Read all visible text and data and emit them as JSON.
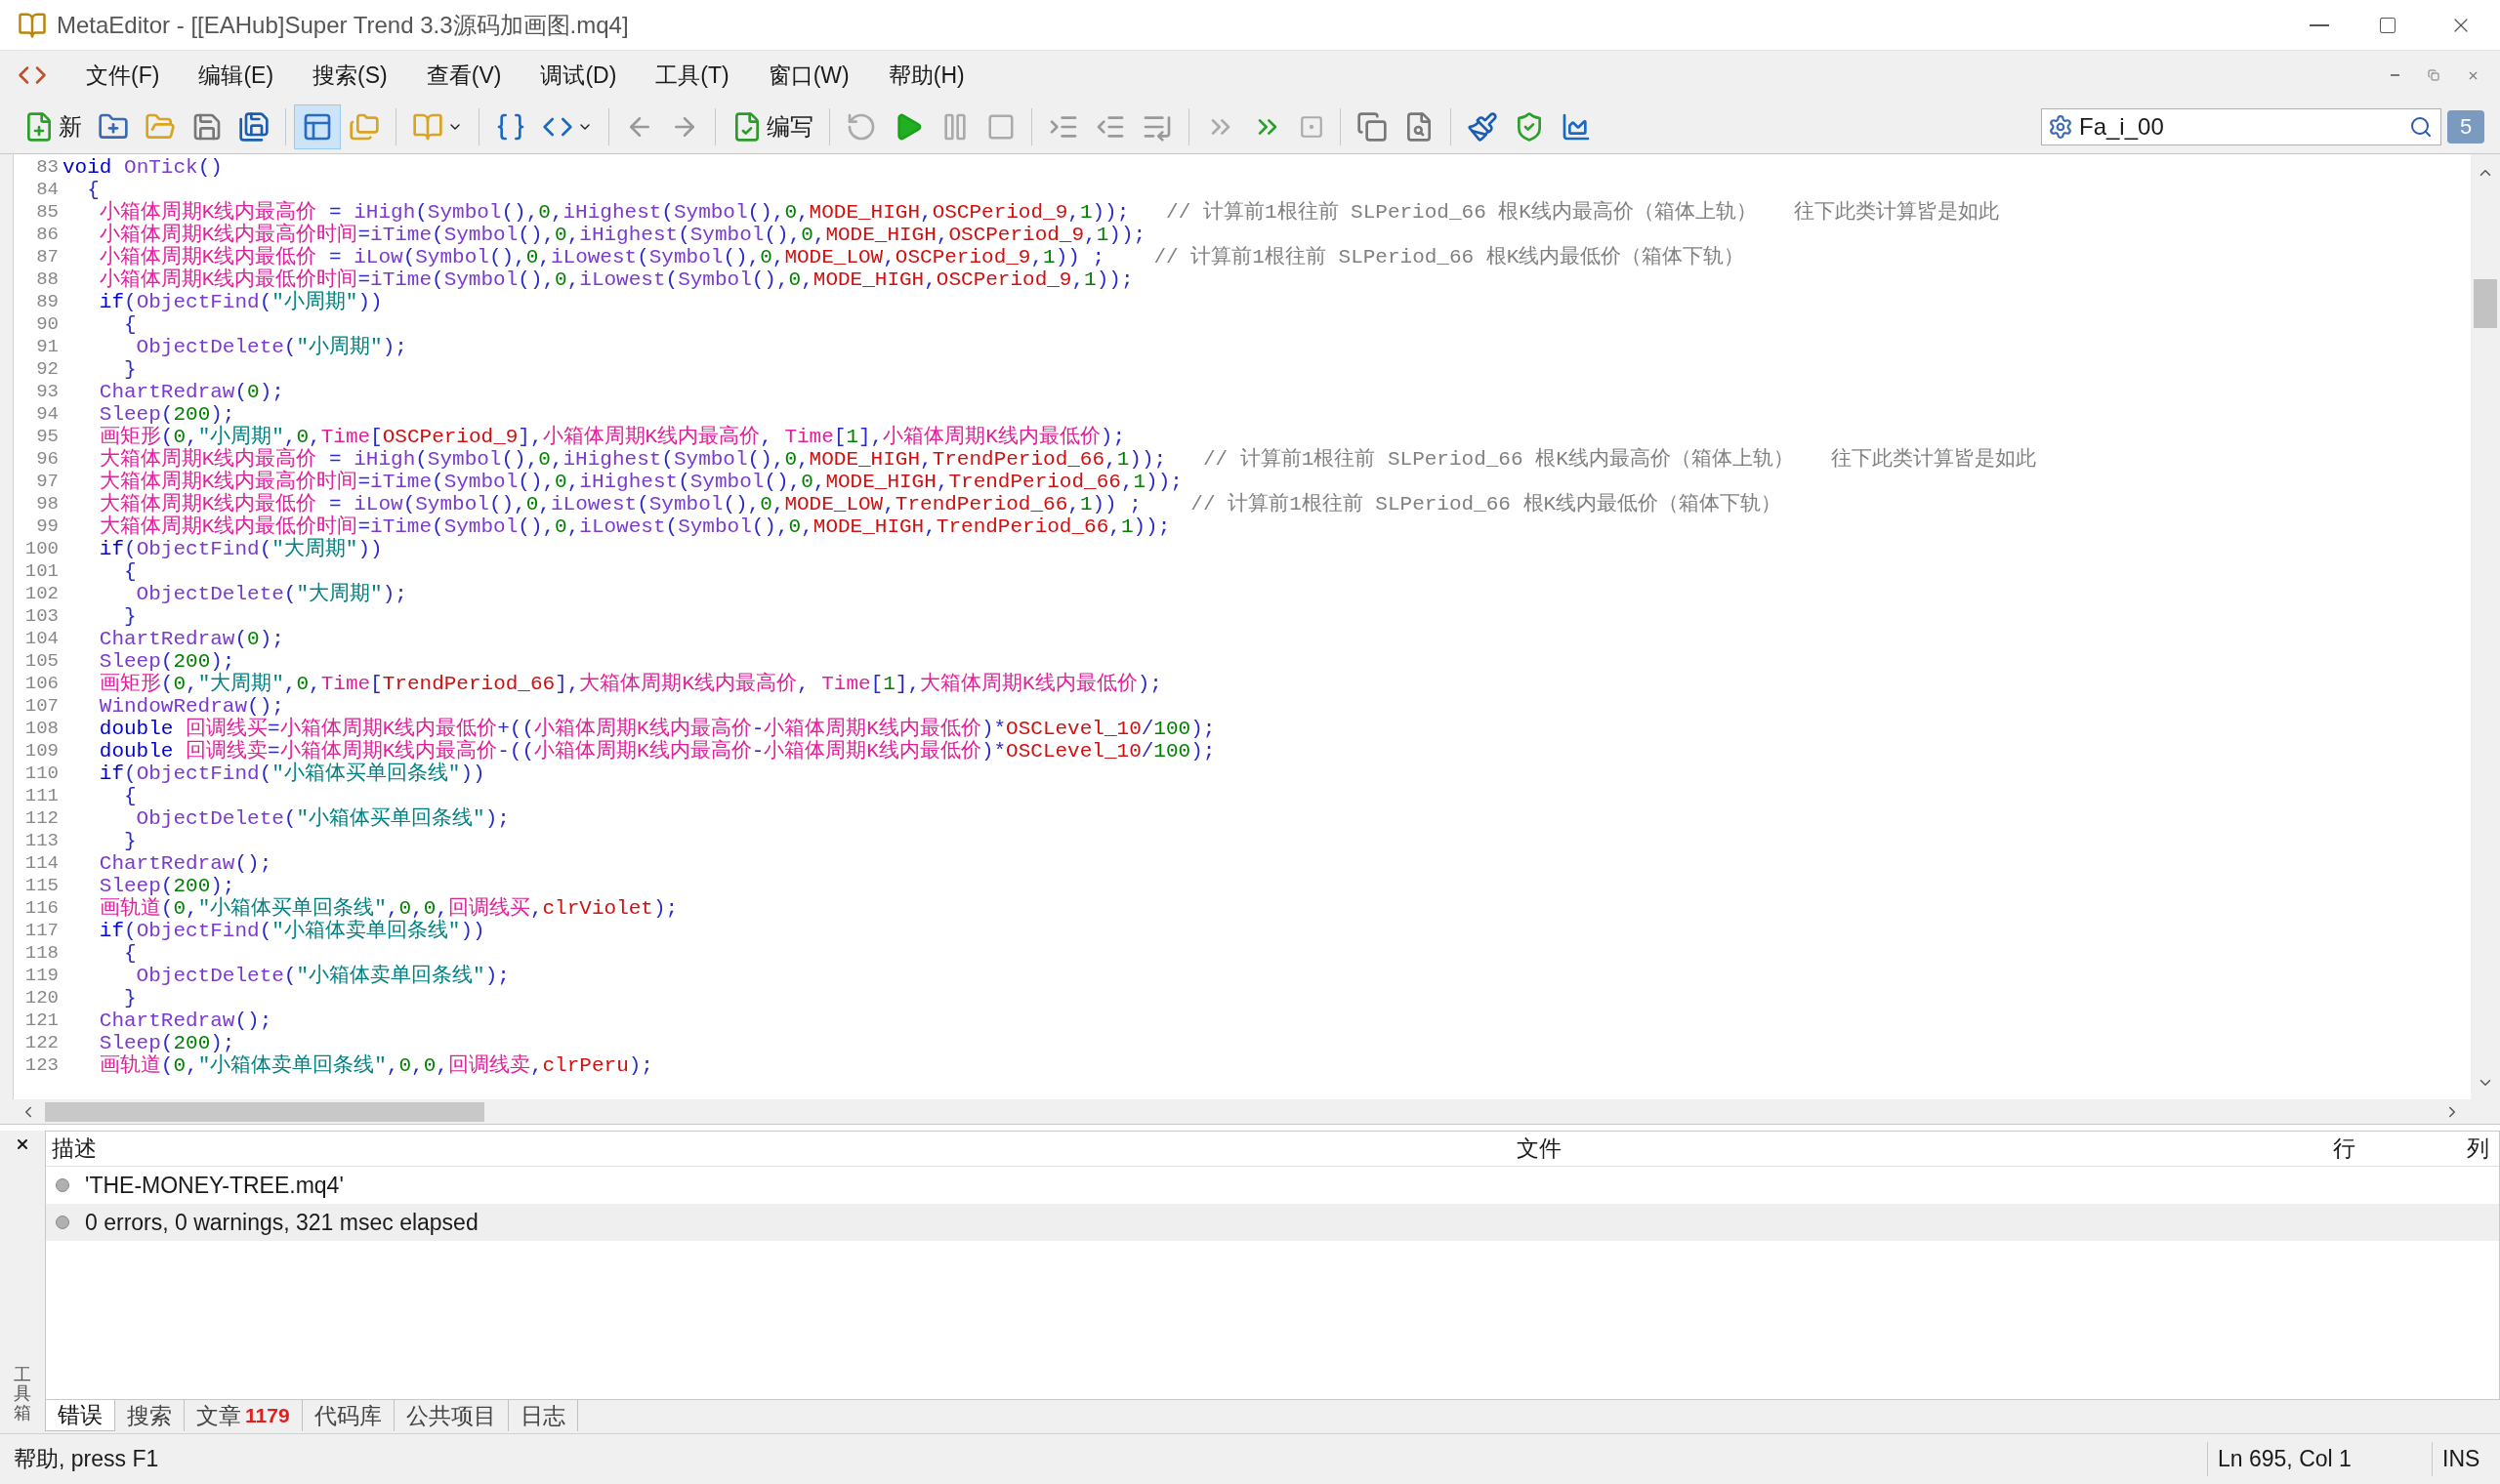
{
  "window": {
    "title": "MetaEditor - [[EAHub]Super Trend 3.3源码加画图.mq4]"
  },
  "menu": [
    "文件(F)",
    "编辑(E)",
    "搜索(S)",
    "查看(V)",
    "调试(D)",
    "工具(T)",
    "窗口(W)",
    "帮助(H)"
  ],
  "toolbar": {
    "new_label": "新",
    "compile_label": "编写",
    "navigator_on": true,
    "search_value": "Fa_i_00",
    "messages_count": "5"
  },
  "editor": {
    "lines": [
      {
        "number": "83",
        "tokens": [
          {
            "kind": "kw",
            "text": "void"
          },
          {
            "kind": "fn",
            "text": " OnTick"
          },
          {
            "kind": "p",
            "text": "()"
          }
        ]
      },
      {
        "number": "84",
        "tokens": [
          {
            "kind": "p",
            "text": "  {"
          }
        ]
      },
      {
        "number": "85",
        "tokens": [
          {
            "kind": "var",
            "text": "   小箱体周期K线内最高价"
          },
          {
            "kind": "p",
            "text": " = "
          },
          {
            "kind": "fn",
            "text": "iHigh"
          },
          {
            "kind": "p",
            "text": "("
          },
          {
            "kind": "fn",
            "text": "Symbol"
          },
          {
            "kind": "p",
            "text": "(),"
          },
          {
            "kind": "num",
            "text": "0"
          },
          {
            "kind": "p",
            "text": ","
          },
          {
            "kind": "fn",
            "text": "iHighest"
          },
          {
            "kind": "p",
            "text": "("
          },
          {
            "kind": "fn",
            "text": "Symbol"
          },
          {
            "kind": "p",
            "text": "(),"
          },
          {
            "kind": "num",
            "text": "0"
          },
          {
            "kind": "p",
            "text": ","
          },
          {
            "kind": "const",
            "text": "MODE_HIGH"
          },
          {
            "kind": "p",
            "text": ","
          },
          {
            "kind": "const",
            "text": "OSCPeriod_9"
          },
          {
            "kind": "p",
            "text": ","
          },
          {
            "kind": "num",
            "text": "1"
          },
          {
            "kind": "p",
            "text": "));"
          },
          {
            "kind": "cmt",
            "text": "   // 计算前1根往前 SLPeriod_66 根K线内最高价（箱体上轨）   往下此类计算皆是如此"
          }
        ]
      },
      {
        "number": "86",
        "tokens": [
          {
            "kind": "var",
            "text": "   小箱体周期K线内最高价时间"
          },
          {
            "kind": "p",
            "text": "="
          },
          {
            "kind": "fn",
            "text": "iTime"
          },
          {
            "kind": "p",
            "text": "("
          },
          {
            "kind": "fn",
            "text": "Symbol"
          },
          {
            "kind": "p",
            "text": "(),"
          },
          {
            "kind": "num",
            "text": "0"
          },
          {
            "kind": "p",
            "text": ","
          },
          {
            "kind": "fn",
            "text": "iHighest"
          },
          {
            "kind": "p",
            "text": "("
          },
          {
            "kind": "fn",
            "text": "Symbol"
          },
          {
            "kind": "p",
            "text": "(),"
          },
          {
            "kind": "num",
            "text": "0"
          },
          {
            "kind": "p",
            "text": ","
          },
          {
            "kind": "const",
            "text": "MODE_HIGH"
          },
          {
            "kind": "p",
            "text": ","
          },
          {
            "kind": "const",
            "text": "OSCPeriod_9"
          },
          {
            "kind": "p",
            "text": ","
          },
          {
            "kind": "num",
            "text": "1"
          },
          {
            "kind": "p",
            "text": "));"
          }
        ]
      },
      {
        "number": "87",
        "tokens": [
          {
            "kind": "var",
            "text": "   小箱体周期K线内最低价"
          },
          {
            "kind": "p",
            "text": " = "
          },
          {
            "kind": "fn",
            "text": "iLow"
          },
          {
            "kind": "p",
            "text": "("
          },
          {
            "kind": "fn",
            "text": "Symbol"
          },
          {
            "kind": "p",
            "text": "(),"
          },
          {
            "kind": "num",
            "text": "0"
          },
          {
            "kind": "p",
            "text": ","
          },
          {
            "kind": "fn",
            "text": "iLowest"
          },
          {
            "kind": "p",
            "text": "("
          },
          {
            "kind": "fn",
            "text": "Symbol"
          },
          {
            "kind": "p",
            "text": "(),"
          },
          {
            "kind": "num",
            "text": "0"
          },
          {
            "kind": "p",
            "text": ","
          },
          {
            "kind": "const",
            "text": "MODE_LOW"
          },
          {
            "kind": "p",
            "text": ","
          },
          {
            "kind": "const",
            "text": "OSCPeriod_9"
          },
          {
            "kind": "p",
            "text": ","
          },
          {
            "kind": "num",
            "text": "1"
          },
          {
            "kind": "p",
            "text": ")) ;"
          },
          {
            "kind": "cmt",
            "text": "    // 计算前1根往前 SLPeriod_66 根K线内最低价（箱体下轨）"
          }
        ]
      },
      {
        "number": "88",
        "tokens": [
          {
            "kind": "var",
            "text": "   小箱体周期K线内最低价时间"
          },
          {
            "kind": "p",
            "text": "="
          },
          {
            "kind": "fn",
            "text": "iTime"
          },
          {
            "kind": "p",
            "text": "("
          },
          {
            "kind": "fn",
            "text": "Symbol"
          },
          {
            "kind": "p",
            "text": "(),"
          },
          {
            "kind": "num",
            "text": "0"
          },
          {
            "kind": "p",
            "text": ","
          },
          {
            "kind": "fn",
            "text": "iLowest"
          },
          {
            "kind": "p",
            "text": "("
          },
          {
            "kind": "fn",
            "text": "Symbol"
          },
          {
            "kind": "p",
            "text": "(),"
          },
          {
            "kind": "num",
            "text": "0"
          },
          {
            "kind": "p",
            "text": ","
          },
          {
            "kind": "const",
            "text": "MODE_HIGH"
          },
          {
            "kind": "p",
            "text": ","
          },
          {
            "kind": "const",
            "text": "OSCPeriod_9"
          },
          {
            "kind": "p",
            "text": ","
          },
          {
            "kind": "num",
            "text": "1"
          },
          {
            "kind": "p",
            "text": "));"
          }
        ]
      },
      {
        "number": "89",
        "tokens": [
          {
            "kind": "kw",
            "text": "   if"
          },
          {
            "kind": "p",
            "text": "("
          },
          {
            "kind": "fn",
            "text": "ObjectFind"
          },
          {
            "kind": "p",
            "text": "("
          },
          {
            "kind": "str",
            "text": "\"小周期\""
          },
          {
            "kind": "p",
            "text": "))"
          }
        ]
      },
      {
        "number": "90",
        "tokens": [
          {
            "kind": "p",
            "text": "     {"
          }
        ]
      },
      {
        "number": "91",
        "tokens": [
          {
            "kind": "fn",
            "text": "      ObjectDelete"
          },
          {
            "kind": "p",
            "text": "("
          },
          {
            "kind": "str",
            "text": "\"小周期\""
          },
          {
            "kind": "p",
            "text": ");"
          }
        ]
      },
      {
        "number": "92",
        "tokens": [
          {
            "kind": "p",
            "text": "     }"
          }
        ]
      },
      {
        "number": "93",
        "tokens": [
          {
            "kind": "fn",
            "text": "   ChartRedraw"
          },
          {
            "kind": "p",
            "text": "("
          },
          {
            "kind": "num",
            "text": "0"
          },
          {
            "kind": "p",
            "text": ");"
          }
        ]
      },
      {
        "number": "94",
        "tokens": [
          {
            "kind": "fn",
            "text": "   Sleep"
          },
          {
            "kind": "p",
            "text": "("
          },
          {
            "kind": "num",
            "text": "200"
          },
          {
            "kind": "p",
            "text": ");"
          }
        ]
      },
      {
        "number": "95",
        "tokens": [
          {
            "kind": "var",
            "text": "   画矩形"
          },
          {
            "kind": "p",
            "text": "("
          },
          {
            "kind": "num",
            "text": "0"
          },
          {
            "kind": "p",
            "text": ","
          },
          {
            "kind": "str",
            "text": "\"小周期\""
          },
          {
            "kind": "p",
            "text": ","
          },
          {
            "kind": "num",
            "text": "0"
          },
          {
            "kind": "p",
            "text": ","
          },
          {
            "kind": "var",
            "text": "Time"
          },
          {
            "kind": "p",
            "text": "["
          },
          {
            "kind": "const",
            "text": "OSCPeriod_9"
          },
          {
            "kind": "p",
            "text": "],"
          },
          {
            "kind": "var",
            "text": "小箱体周期K线内最高价"
          },
          {
            "kind": "p",
            "text": ","
          },
          {
            "kind": "var",
            "text": " Time"
          },
          {
            "kind": "p",
            "text": "["
          },
          {
            "kind": "num",
            "text": "1"
          },
          {
            "kind": "p",
            "text": "],"
          },
          {
            "kind": "var",
            "text": "小箱体周期K线内最低价"
          },
          {
            "kind": "p",
            "text": ");"
          }
        ]
      },
      {
        "number": "96",
        "tokens": [
          {
            "kind": "var",
            "text": "   大箱体周期K线内最高价"
          },
          {
            "kind": "p",
            "text": " = "
          },
          {
            "kind": "fn",
            "text": "iHigh"
          },
          {
            "kind": "p",
            "text": "("
          },
          {
            "kind": "fn",
            "text": "Symbol"
          },
          {
            "kind": "p",
            "text": "(),"
          },
          {
            "kind": "num",
            "text": "0"
          },
          {
            "kind": "p",
            "text": ","
          },
          {
            "kind": "fn",
            "text": "iHighest"
          },
          {
            "kind": "p",
            "text": "("
          },
          {
            "kind": "fn",
            "text": "Symbol"
          },
          {
            "kind": "p",
            "text": "(),"
          },
          {
            "kind": "num",
            "text": "0"
          },
          {
            "kind": "p",
            "text": ","
          },
          {
            "kind": "const",
            "text": "MODE_HIGH"
          },
          {
            "kind": "p",
            "text": ","
          },
          {
            "kind": "const",
            "text": "TrendPeriod_66"
          },
          {
            "kind": "p",
            "text": ","
          },
          {
            "kind": "num",
            "text": "1"
          },
          {
            "kind": "p",
            "text": "));"
          },
          {
            "kind": "cmt",
            "text": "   // 计算前1根往前 SLPeriod_66 根K线内最高价（箱体上轨）   往下此类计算皆是如此"
          }
        ]
      },
      {
        "number": "97",
        "tokens": [
          {
            "kind": "var",
            "text": "   大箱体周期K线内最高价时间"
          },
          {
            "kind": "p",
            "text": "="
          },
          {
            "kind": "fn",
            "text": "iTime"
          },
          {
            "kind": "p",
            "text": "("
          },
          {
            "kind": "fn",
            "text": "Symbol"
          },
          {
            "kind": "p",
            "text": "(),"
          },
          {
            "kind": "num",
            "text": "0"
          },
          {
            "kind": "p",
            "text": ","
          },
          {
            "kind": "fn",
            "text": "iHighest"
          },
          {
            "kind": "p",
            "text": "("
          },
          {
            "kind": "fn",
            "text": "Symbol"
          },
          {
            "kind": "p",
            "text": "(),"
          },
          {
            "kind": "num",
            "text": "0"
          },
          {
            "kind": "p",
            "text": ","
          },
          {
            "kind": "const",
            "text": "MODE_HIGH"
          },
          {
            "kind": "p",
            "text": ","
          },
          {
            "kind": "const",
            "text": "TrendPeriod_66"
          },
          {
            "kind": "p",
            "text": ","
          },
          {
            "kind": "num",
            "text": "1"
          },
          {
            "kind": "p",
            "text": "));"
          }
        ]
      },
      {
        "number": "98",
        "tokens": [
          {
            "kind": "var",
            "text": "   大箱体周期K线内最低价"
          },
          {
            "kind": "p",
            "text": " = "
          },
          {
            "kind": "fn",
            "text": "iLow"
          },
          {
            "kind": "p",
            "text": "("
          },
          {
            "kind": "fn",
            "text": "Symbol"
          },
          {
            "kind": "p",
            "text": "(),"
          },
          {
            "kind": "num",
            "text": "0"
          },
          {
            "kind": "p",
            "text": ","
          },
          {
            "kind": "fn",
            "text": "iLowest"
          },
          {
            "kind": "p",
            "text": "("
          },
          {
            "kind": "fn",
            "text": "Symbol"
          },
          {
            "kind": "p",
            "text": "(),"
          },
          {
            "kind": "num",
            "text": "0"
          },
          {
            "kind": "p",
            "text": ","
          },
          {
            "kind": "const",
            "text": "MODE_LOW"
          },
          {
            "kind": "p",
            "text": ","
          },
          {
            "kind": "const",
            "text": "TrendPeriod_66"
          },
          {
            "kind": "p",
            "text": ","
          },
          {
            "kind": "num",
            "text": "1"
          },
          {
            "kind": "p",
            "text": ")) ;"
          },
          {
            "kind": "cmt",
            "text": "    // 计算前1根往前 SLPeriod_66 根K线内最低价（箱体下轨）"
          }
        ]
      },
      {
        "number": "99",
        "tokens": [
          {
            "kind": "var",
            "text": "   大箱体周期K线内最低价时间"
          },
          {
            "kind": "p",
            "text": "="
          },
          {
            "kind": "fn",
            "text": "iTime"
          },
          {
            "kind": "p",
            "text": "("
          },
          {
            "kind": "fn",
            "text": "Symbol"
          },
          {
            "kind": "p",
            "text": "(),"
          },
          {
            "kind": "num",
            "text": "0"
          },
          {
            "kind": "p",
            "text": ","
          },
          {
            "kind": "fn",
            "text": "iLowest"
          },
          {
            "kind": "p",
            "text": "("
          },
          {
            "kind": "fn",
            "text": "Symbol"
          },
          {
            "kind": "p",
            "text": "(),"
          },
          {
            "kind": "num",
            "text": "0"
          },
          {
            "kind": "p",
            "text": ","
          },
          {
            "kind": "const",
            "text": "MODE_HIGH"
          },
          {
            "kind": "p",
            "text": ","
          },
          {
            "kind": "const",
            "text": "TrendPeriod_66"
          },
          {
            "kind": "p",
            "text": ","
          },
          {
            "kind": "num",
            "text": "1"
          },
          {
            "kind": "p",
            "text": "));"
          }
        ]
      },
      {
        "number": "100",
        "tokens": [
          {
            "kind": "kw",
            "text": "   if"
          },
          {
            "kind": "p",
            "text": "("
          },
          {
            "kind": "fn",
            "text": "ObjectFind"
          },
          {
            "kind": "p",
            "text": "("
          },
          {
            "kind": "str",
            "text": "\"大周期\""
          },
          {
            "kind": "p",
            "text": "))"
          }
        ]
      },
      {
        "number": "101",
        "tokens": [
          {
            "kind": "p",
            "text": "     {"
          }
        ]
      },
      {
        "number": "102",
        "tokens": [
          {
            "kind": "fn",
            "text": "      ObjectDelete"
          },
          {
            "kind": "p",
            "text": "("
          },
          {
            "kind": "str",
            "text": "\"大周期\""
          },
          {
            "kind": "p",
            "text": ");"
          }
        ]
      },
      {
        "number": "103",
        "tokens": [
          {
            "kind": "p",
            "text": "     }"
          }
        ]
      },
      {
        "number": "104",
        "tokens": [
          {
            "kind": "fn",
            "text": "   ChartRedraw"
          },
          {
            "kind": "p",
            "text": "("
          },
          {
            "kind": "num",
            "text": "0"
          },
          {
            "kind": "p",
            "text": ");"
          }
        ]
      },
      {
        "number": "105",
        "tokens": [
          {
            "kind": "fn",
            "text": "   Sleep"
          },
          {
            "kind": "p",
            "text": "("
          },
          {
            "kind": "num",
            "text": "200"
          },
          {
            "kind": "p",
            "text": ");"
          }
        ]
      },
      {
        "number": "106",
        "tokens": [
          {
            "kind": "var",
            "text": "   画矩形"
          },
          {
            "kind": "p",
            "text": "("
          },
          {
            "kind": "num",
            "text": "0"
          },
          {
            "kind": "p",
            "text": ","
          },
          {
            "kind": "str",
            "text": "\"大周期\""
          },
          {
            "kind": "p",
            "text": ","
          },
          {
            "kind": "num",
            "text": "0"
          },
          {
            "kind": "p",
            "text": ","
          },
          {
            "kind": "var",
            "text": "Time"
          },
          {
            "kind": "p",
            "text": "["
          },
          {
            "kind": "const",
            "text": "TrendPeriod_66"
          },
          {
            "kind": "p",
            "text": "],"
          },
          {
            "kind": "var",
            "text": "大箱体周期K线内最高价"
          },
          {
            "kind": "p",
            "text": ","
          },
          {
            "kind": "var",
            "text": " Time"
          },
          {
            "kind": "p",
            "text": "["
          },
          {
            "kind": "num",
            "text": "1"
          },
          {
            "kind": "p",
            "text": "],"
          },
          {
            "kind": "var",
            "text": "大箱体周期K线内最低价"
          },
          {
            "kind": "p",
            "text": ");"
          }
        ]
      },
      {
        "number": "107",
        "tokens": [
          {
            "kind": "fn",
            "text": "   WindowRedraw"
          },
          {
            "kind": "p",
            "text": "();"
          }
        ]
      },
      {
        "number": "108",
        "tokens": [
          {
            "kind": "kw",
            "text": "   double"
          },
          {
            "kind": "var",
            "text": " 回调线买"
          },
          {
            "kind": "p",
            "text": "="
          },
          {
            "kind": "var",
            "text": "小箱体周期K线内最低价"
          },
          {
            "kind": "p",
            "text": "+(("
          },
          {
            "kind": "var",
            "text": "小箱体周期K线内最高价"
          },
          {
            "kind": "p",
            "text": "-"
          },
          {
            "kind": "var",
            "text": "小箱体周期K线内最低价"
          },
          {
            "kind": "p",
            "text": ")*"
          },
          {
            "kind": "const",
            "text": "OSCLevel_10"
          },
          {
            "kind": "p",
            "text": "/"
          },
          {
            "kind": "num",
            "text": "100"
          },
          {
            "kind": "p",
            "text": ");"
          }
        ]
      },
      {
        "number": "109",
        "tokens": [
          {
            "kind": "kw",
            "text": "   double"
          },
          {
            "kind": "var",
            "text": " 回调线卖"
          },
          {
            "kind": "p",
            "text": "="
          },
          {
            "kind": "var",
            "text": "小箱体周期K线内最高价"
          },
          {
            "kind": "p",
            "text": "-(("
          },
          {
            "kind": "var",
            "text": "小箱体周期K线内最高价"
          },
          {
            "kind": "p",
            "text": "-"
          },
          {
            "kind": "var",
            "text": "小箱体周期K线内最低价"
          },
          {
            "kind": "p",
            "text": ")*"
          },
          {
            "kind": "const",
            "text": "OSCLevel_10"
          },
          {
            "kind": "p",
            "text": "/"
          },
          {
            "kind": "num",
            "text": "100"
          },
          {
            "kind": "p",
            "text": ");"
          }
        ]
      },
      {
        "number": "110",
        "tokens": [
          {
            "kind": "kw",
            "text": "   if"
          },
          {
            "kind": "p",
            "text": "("
          },
          {
            "kind": "fn",
            "text": "ObjectFind"
          },
          {
            "kind": "p",
            "text": "("
          },
          {
            "kind": "str",
            "text": "\"小箱体买单回条线\""
          },
          {
            "kind": "p",
            "text": "))"
          }
        ]
      },
      {
        "number": "111",
        "tokens": [
          {
            "kind": "p",
            "text": "     {"
          }
        ]
      },
      {
        "number": "112",
        "tokens": [
          {
            "kind": "fn",
            "text": "      ObjectDelete"
          },
          {
            "kind": "p",
            "text": "("
          },
          {
            "kind": "str",
            "text": "\"小箱体买单回条线\""
          },
          {
            "kind": "p",
            "text": ");"
          }
        ]
      },
      {
        "number": "113",
        "tokens": [
          {
            "kind": "p",
            "text": "     }"
          }
        ]
      },
      {
        "number": "114",
        "tokens": [
          {
            "kind": "fn",
            "text": "   ChartRedraw"
          },
          {
            "kind": "p",
            "text": "();"
          }
        ]
      },
      {
        "number": "115",
        "tokens": [
          {
            "kind": "fn",
            "text": "   Sleep"
          },
          {
            "kind": "p",
            "text": "("
          },
          {
            "kind": "num",
            "text": "200"
          },
          {
            "kind": "p",
            "text": ");"
          }
        ]
      },
      {
        "number": "116",
        "tokens": [
          {
            "kind": "var",
            "text": "   画轨道"
          },
          {
            "kind": "p",
            "text": "("
          },
          {
            "kind": "num",
            "text": "0"
          },
          {
            "kind": "p",
            "text": ","
          },
          {
            "kind": "str",
            "text": "\"小箱体买单回条线\""
          },
          {
            "kind": "p",
            "text": ","
          },
          {
            "kind": "num",
            "text": "0"
          },
          {
            "kind": "p",
            "text": ","
          },
          {
            "kind": "num",
            "text": "0"
          },
          {
            "kind": "p",
            "text": ","
          },
          {
            "kind": "var",
            "text": "回调线买"
          },
          {
            "kind": "p",
            "text": ","
          },
          {
            "kind": "const",
            "text": "clrViolet"
          },
          {
            "kind": "p",
            "text": ");"
          }
        ]
      },
      {
        "number": "117",
        "tokens": [
          {
            "kind": "kw",
            "text": "   if"
          },
          {
            "kind": "p",
            "text": "("
          },
          {
            "kind": "fn",
            "text": "ObjectFind"
          },
          {
            "kind": "p",
            "text": "("
          },
          {
            "kind": "str",
            "text": "\"小箱体卖单回条线\""
          },
          {
            "kind": "p",
            "text": "))"
          }
        ]
      },
      {
        "number": "118",
        "tokens": [
          {
            "kind": "p",
            "text": "     {"
          }
        ]
      },
      {
        "number": "119",
        "tokens": [
          {
            "kind": "fn",
            "text": "      ObjectDelete"
          },
          {
            "kind": "p",
            "text": "("
          },
          {
            "kind": "str",
            "text": "\"小箱体卖单回条线\""
          },
          {
            "kind": "p",
            "text": ");"
          }
        ]
      },
      {
        "number": "120",
        "tokens": [
          {
            "kind": "p",
            "text": "     }"
          }
        ]
      },
      {
        "number": "121",
        "tokens": [
          {
            "kind": "fn",
            "text": "   ChartRedraw"
          },
          {
            "kind": "p",
            "text": "();"
          }
        ]
      },
      {
        "number": "122",
        "tokens": [
          {
            "kind": "fn",
            "text": "   Sleep"
          },
          {
            "kind": "p",
            "text": "("
          },
          {
            "kind": "num",
            "text": "200"
          },
          {
            "kind": "p",
            "text": ");"
          }
        ]
      },
      {
        "number": "123",
        "tokens": [
          {
            "kind": "var",
            "text": "   画轨道"
          },
          {
            "kind": "p",
            "text": "("
          },
          {
            "kind": "num",
            "text": "0"
          },
          {
            "kind": "p",
            "text": ","
          },
          {
            "kind": "str",
            "text": "\"小箱体卖单回条线\""
          },
          {
            "kind": "p",
            "text": ","
          },
          {
            "kind": "num",
            "text": "0"
          },
          {
            "kind": "p",
            "text": ","
          },
          {
            "kind": "num",
            "text": "0"
          },
          {
            "kind": "p",
            "text": ","
          },
          {
            "kind": "var",
            "text": "回调线卖"
          },
          {
            "kind": "p",
            "text": ","
          },
          {
            "kind": "const",
            "text": "clrPeru"
          },
          {
            "kind": "p",
            "text": ");"
          }
        ]
      }
    ]
  },
  "toolbox": {
    "title": "工具箱",
    "columns": [
      "描述",
      "文件",
      "行",
      "列"
    ],
    "rows": [
      {
        "description": "'THE-MONEY-TREE.mq4'",
        "selected": false
      },
      {
        "description": "0 errors, 0 warnings, 321 msec elapsed",
        "selected": true
      }
    ],
    "tabs": [
      {
        "label": "错误",
        "selected": true
      },
      {
        "label": "搜索",
        "selected": false
      },
      {
        "label": "文章",
        "count": "1179",
        "selected": false
      },
      {
        "label": "代码库",
        "selected": false
      },
      {
        "label": "公共项目",
        "selected": false
      },
      {
        "label": "日志",
        "selected": false
      }
    ]
  },
  "status_bar": {
    "help": "帮助, press F1",
    "position": "Ln 695, Col 1",
    "mode": "INS"
  }
}
